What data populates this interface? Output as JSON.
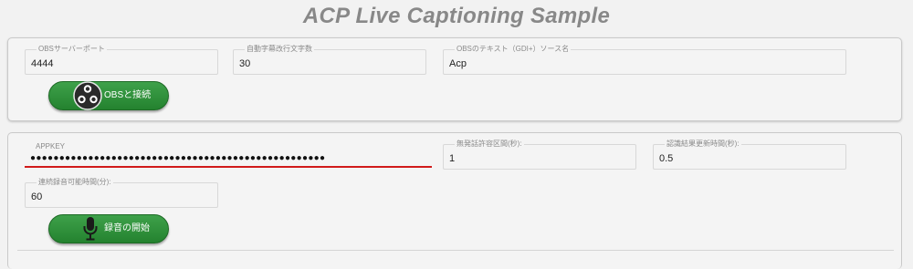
{
  "page": {
    "title": "ACP Live Captioning Sample"
  },
  "obs_panel": {
    "server_port": {
      "label": "OBSサーバーポート",
      "value": "4444"
    },
    "line_break_chars": {
      "label": "自動字幕改行文字数",
      "value": "30"
    },
    "text_source": {
      "label": "OBSのテキスト（GDI+）ソース名",
      "value": "Acp"
    },
    "connect_button": {
      "label": "OBSと接続",
      "icon": "obs-icon"
    }
  },
  "recognition_panel": {
    "appkey": {
      "label": "APPKEY",
      "value": "●●●●●●●●●●●●●●●●●●●●●●●●●●●●●●●●●●●●●●●●●●●●●●●●●●●",
      "underline_color": "#d11a1a"
    },
    "silence_interval": {
      "label": "無発話許容区間(秒):",
      "value": "1"
    },
    "update_time": {
      "label": "認識結果更新時間(秒):",
      "value": "0.5"
    },
    "max_recording_time": {
      "label": "連続録音可能時間(分):",
      "value": "60"
    },
    "record_button": {
      "label": "録音の開始",
      "icon": "microphone-icon"
    }
  },
  "colors": {
    "title": "#888888",
    "button_green": "#2e8f3a",
    "error_underline": "#d11a1a"
  }
}
